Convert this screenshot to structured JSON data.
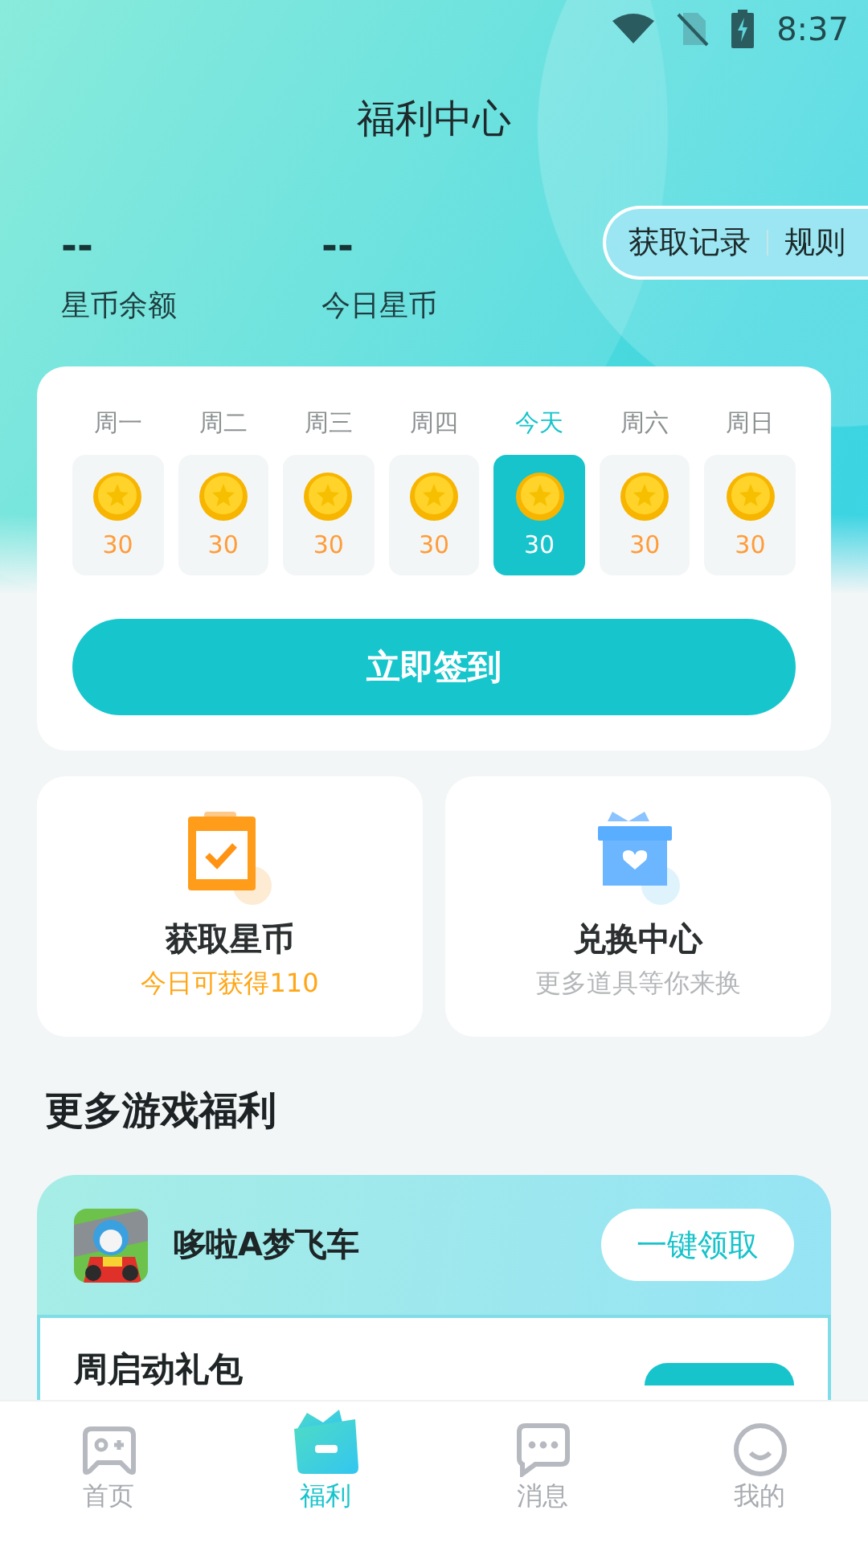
{
  "status_bar": {
    "time": "8:37"
  },
  "title": "福利中心",
  "stats": [
    {
      "value": "--",
      "label": "星币余额"
    },
    {
      "value": "--",
      "label": "今日星币"
    }
  ],
  "header_links": [
    "获取记录",
    "规则"
  ],
  "checkin": {
    "days": [
      {
        "label": "周一",
        "coins": "30",
        "selected": false
      },
      {
        "label": "周二",
        "coins": "30",
        "selected": false
      },
      {
        "label": "周三",
        "coins": "30",
        "selected": false
      },
      {
        "label": "周四",
        "coins": "30",
        "selected": false
      },
      {
        "label": "今天",
        "coins": "30",
        "selected": true
      },
      {
        "label": "周六",
        "coins": "30",
        "selected": false
      },
      {
        "label": "周日",
        "coins": "30",
        "selected": false
      }
    ],
    "button": "立即签到"
  },
  "features": [
    {
      "kind": "clipboard",
      "title": "获取星币",
      "subtitle": "今日可获得110",
      "highlight": true
    },
    {
      "kind": "gift",
      "title": "兑换中心",
      "subtitle": "更多道具等你来换",
      "highlight": false
    }
  ],
  "section_title": "更多游戏福利",
  "game": {
    "name": "哆啦A梦飞车",
    "button": "一键领取",
    "gifts": [
      {
        "name": "周启动礼包"
      }
    ]
  },
  "nav": [
    {
      "label": "首页",
      "kind": "gamepad",
      "selected": false
    },
    {
      "label": "福利",
      "kind": "gift",
      "selected": true
    },
    {
      "label": "消息",
      "kind": "chat",
      "selected": false
    },
    {
      "label": "我的",
      "kind": "smile",
      "selected": false
    }
  ]
}
